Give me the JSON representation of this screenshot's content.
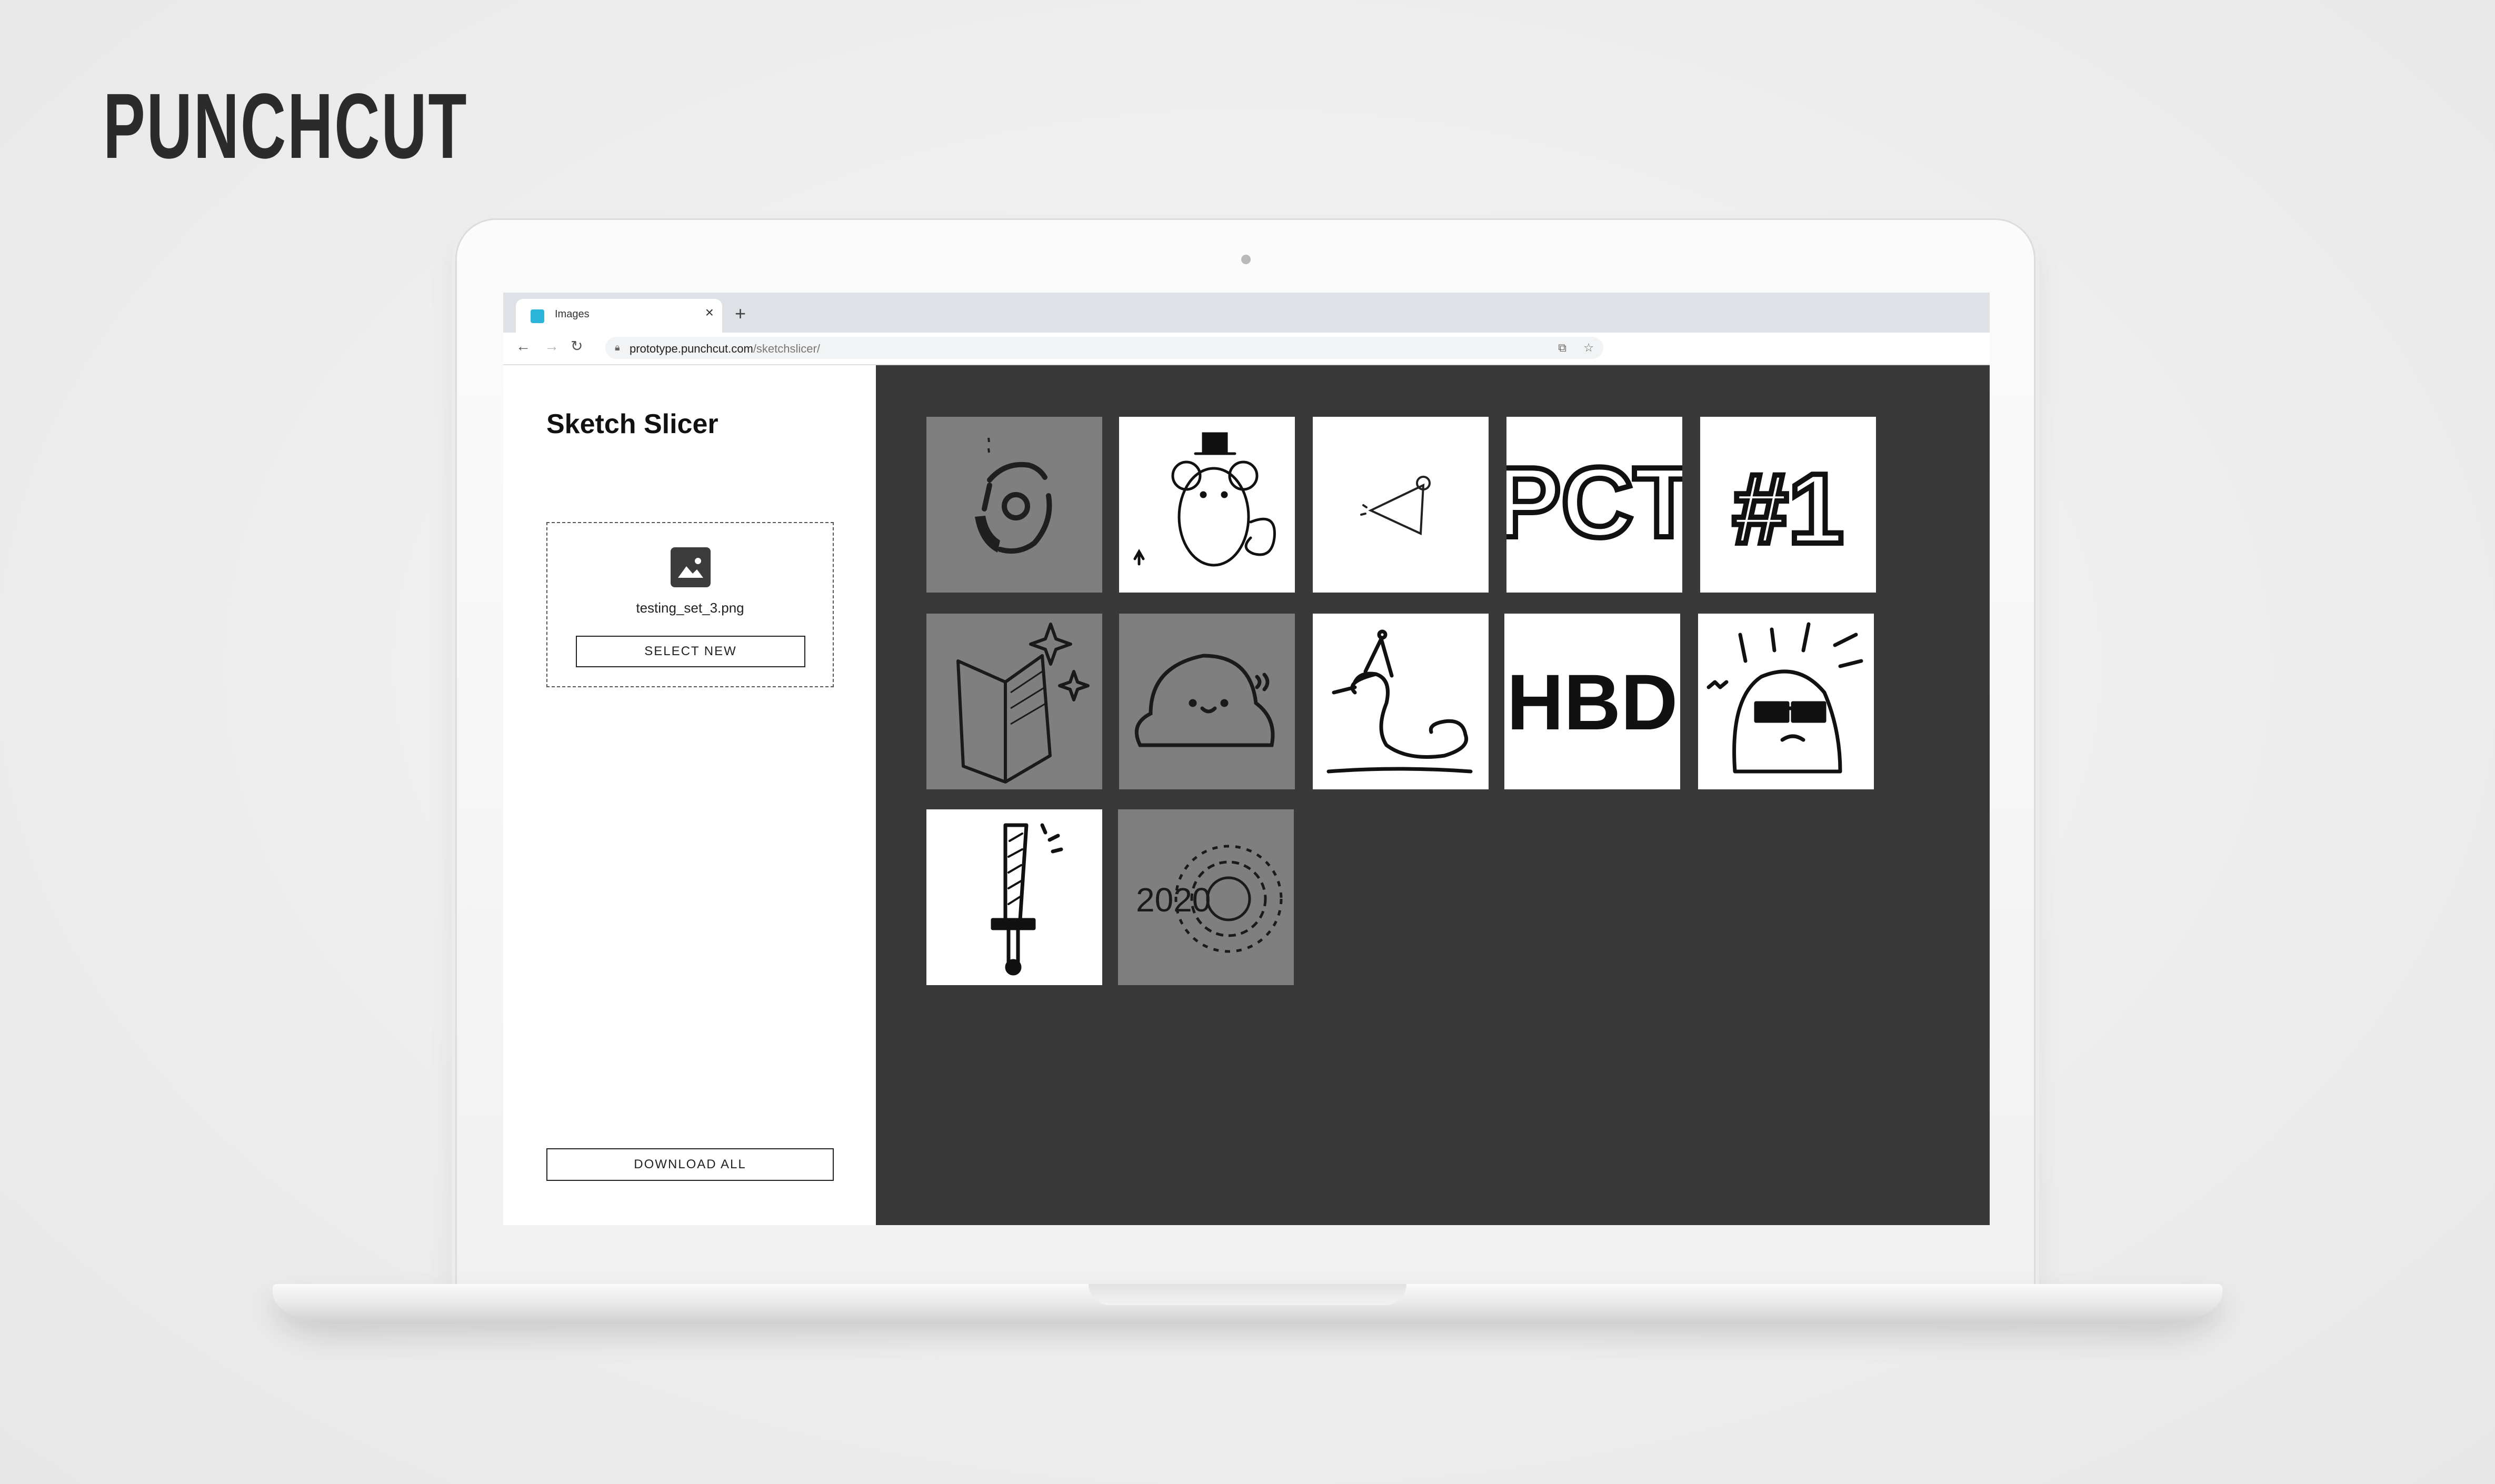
{
  "brand": {
    "logo_text": "PUNCHCUT"
  },
  "browser": {
    "tab_title": "Images",
    "tab_close": "×",
    "new_tab": "+",
    "url_host": "prototype.punchcut.com",
    "url_path": "/sketchslicer/"
  },
  "sidebar": {
    "title": "Sketch Slicer",
    "file_name": "testing_set_3.png",
    "select_label": "SELECT NEW",
    "download_label": "DOWNLOAD ALL"
  },
  "tiles": [
    {
      "subject": "donut-ring-sketch",
      "background": "gray"
    },
    {
      "subject": "mouse-with-top-hat",
      "background": "white"
    },
    {
      "subject": "party-hat",
      "background": "white"
    },
    {
      "subject": "PCT",
      "background": "white"
    },
    {
      "subject": "#1",
      "background": "white"
    },
    {
      "subject": "box-with-sparkles",
      "background": "gray"
    },
    {
      "subject": "blob-creature",
      "background": "gray"
    },
    {
      "subject": "duck-with-party-hat",
      "background": "white"
    },
    {
      "subject": "HBD",
      "background": "white"
    },
    {
      "subject": "angry-ghost-with-sunglasses",
      "background": "white"
    },
    {
      "subject": "sword",
      "background": "white"
    },
    {
      "subject": "2020",
      "background": "gray"
    }
  ]
}
